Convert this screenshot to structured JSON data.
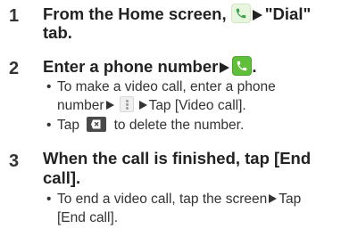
{
  "steps": [
    {
      "number": "1",
      "heading_line1_prefix": "From the Home screen, ",
      "heading_line1_suffix": "\"Dial\"",
      "heading_line2": "tab."
    },
    {
      "number": "2",
      "heading_prefix": "Enter a phone number",
      "heading_suffix": ".",
      "bullets": [
        {
          "line1": "To make a video call, enter a phone",
          "line2_prefix": "number",
          "line2_suffix": "Tap [Video call]."
        },
        {
          "prefix": "Tap",
          "suffix": "to delete the number."
        }
      ]
    },
    {
      "number": "3",
      "heading_line1": "When the call is finished, tap [End",
      "heading_line2": "call].",
      "bullets": [
        {
          "line1_prefix": "To end a video call, tap the screen",
          "line1_suffix": "Tap",
          "line2": "[End call]."
        }
      ]
    }
  ],
  "bullet_char": "•",
  "icons": {
    "dialer": "phone-dialer-icon",
    "call": "call-phone-icon",
    "menu": "menu-dots-icon",
    "delete": "backspace-delete-icon",
    "arrow": "triangle-arrow-icon"
  },
  "colors": {
    "dialer_bg": "#e9f6df",
    "call_green": "#5fbf3a",
    "text": "#222222"
  }
}
